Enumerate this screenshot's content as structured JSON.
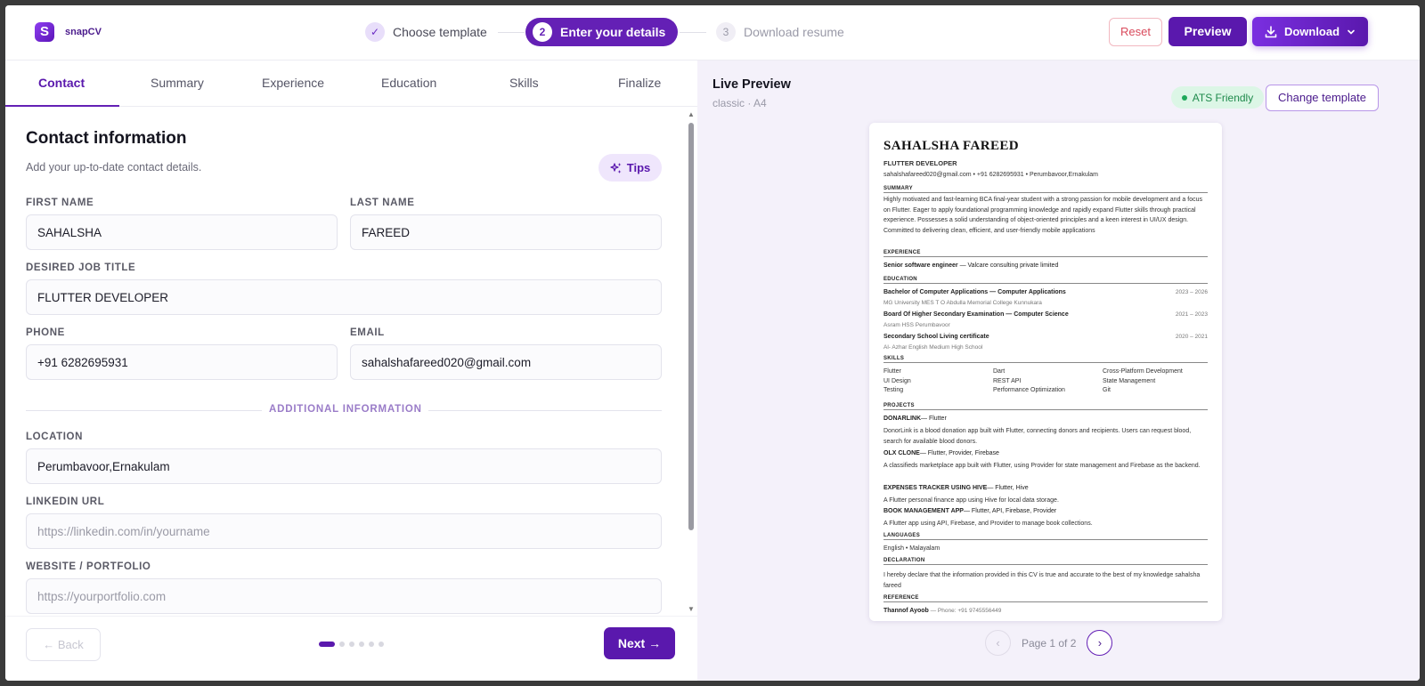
{
  "header": {
    "brand": "snapCV",
    "logo_letter": "S",
    "steps": [
      {
        "num": "✓",
        "label": "Choose template"
      },
      {
        "num": "2",
        "label": "Enter your details"
      },
      {
        "num": "3",
        "label": "Download resume"
      }
    ],
    "reset_label": "Reset",
    "preview_label": "Preview",
    "download_label": "Download"
  },
  "tabs": [
    "Contact",
    "Summary",
    "Experience",
    "Education",
    "Skills",
    "Finalize"
  ],
  "form": {
    "title": "Contact information",
    "subtitle": "Add your up-to-date contact details.",
    "tips_label": "Tips",
    "first_name_label": "FIRST NAME",
    "first_name": "SAHALSHA",
    "last_name_label": "LAST NAME",
    "last_name": "FAREED",
    "job_title_label": "DESIRED JOB TITLE",
    "job_title": "FLUTTER DEVELOPER",
    "phone_label": "PHONE",
    "phone": "+91 6282695931",
    "email_label": "EMAIL",
    "email": "sahalshafareed020@gmail.com",
    "additional_label": "ADDITIONAL INFORMATION",
    "location_label": "LOCATION",
    "location": "Perumbavoor,Ernakulam",
    "linkedin_label": "LINKEDIN URL",
    "linkedin_placeholder": "https://linkedin.com/in/yourname",
    "website_label": "WEBSITE / PORTFOLIO",
    "website_placeholder": "https://yourportfolio.com"
  },
  "footer": {
    "back_label": "← Back",
    "next_label": "Next →",
    "progress_step": 1,
    "progress_total": 6
  },
  "preview": {
    "title": "Live Preview",
    "subtitle": "classic · A4",
    "ats_label": "ATS Friendly",
    "change_template_label": "Change template",
    "page_text": "Page 1 of 2",
    "prev_icon": "‹",
    "next_icon": "›"
  },
  "cv": {
    "name": "SAHALSHA FAREED",
    "role": "FLUTTER DEVELOPER",
    "contact": "sahalshafareed020@gmail.com  •  +91 6282695931  •  Perumbavoor,Ernakulam",
    "summary_heading": "SUMMARY",
    "summary": "Highly motivated and fast-learning BCA final-year student with a strong passion for mobile development and a focus on Flutter. Eager to apply foundational programming knowledge and rapidly expand Flutter skills through practical experience. Possesses a solid understanding of object-oriented principles and a keen interest in UI/UX design. Committed to delivering clean, efficient, and user-friendly mobile applications",
    "experience_heading": "EXPERIENCE",
    "experience_title": "Senior software engineer",
    "experience_company": " — Valcare consulting private limited",
    "education_heading": "EDUCATION",
    "education": [
      {
        "degree": "Bachelor of Computer Applications — Computer Applications",
        "years": "2023 – 2026",
        "school": "MG University MES T O Abdulla Memorial College Kunnukara"
      },
      {
        "degree": "Board Of Higher Secondary Examination — Computer Science",
        "years": "2021 – 2023",
        "school": "Asram HSS Perumbavoor"
      },
      {
        "degree": "Secondary School Living certificate",
        "years": "2020 – 2021",
        "school": "Al- Azhar English Medium High School"
      }
    ],
    "skills_heading": "SKILLS",
    "skills": [
      "Flutter",
      "Dart",
      "Cross-Platform Development",
      "UI Design",
      "REST API",
      "State Management",
      "Testing",
      "Performance Optimization",
      "Git"
    ],
    "projects_heading": "PROJECTS",
    "projects": [
      {
        "name": "DONARLINK",
        "tech": "— Flutter",
        "desc": "DonorLink is a blood donation app built with Flutter, connecting donors and recipients. Users can request blood, search for available blood donors."
      },
      {
        "name": "OLX CLONE",
        "tech": "— Flutter, Provider, Firebase",
        "desc": "A classifieds marketplace app built with Flutter, using Provider for state management and Firebase as the backend."
      },
      {
        "name": "EXPENSES TRACKER USING HIVE",
        "tech": "— Flutter, Hive",
        "desc": "A Flutter personal finance app using Hive for local data storage."
      },
      {
        "name": "BOOK MANAGEMENT APP",
        "tech": "— Flutter, API, Firebase, Provider",
        "desc": "A Flutter app using API, Firebase, and Provider to manage book collections."
      }
    ],
    "languages_heading": "LANGUAGES",
    "languages": "English • Malayalam",
    "declaration_heading": "DECLARATION",
    "declaration": "I hereby declare that the information provided in this CV is true and accurate to the best of my knowledge sahalsha fareed",
    "reference_heading": "REFERENCE",
    "reference_name": "Thannof Ayoob",
    "reference_phone": " — Phone: +91 9745556449"
  },
  "colors": {
    "accent": "#5a18ad",
    "ats_green": "#1fa85a",
    "reset_red": "#d94a5c"
  }
}
